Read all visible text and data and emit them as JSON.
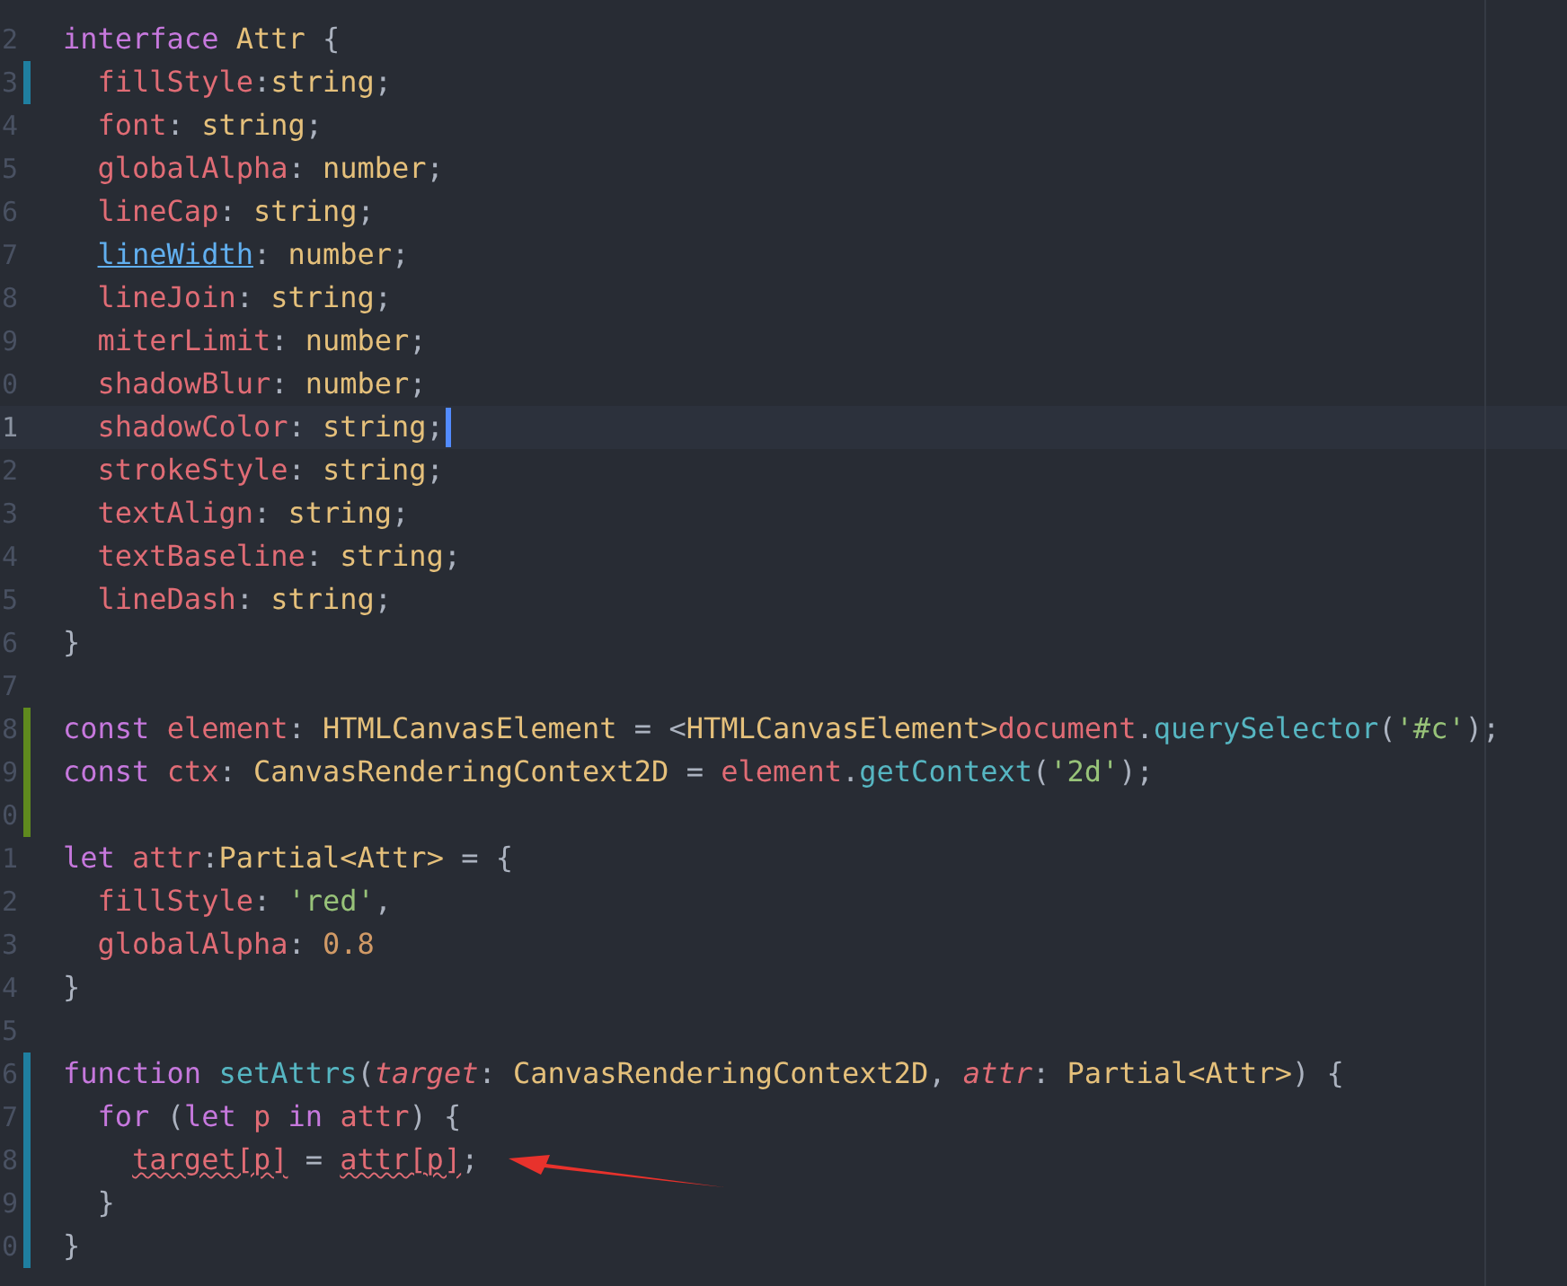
{
  "editor": {
    "lines": [
      {
        "number": "2",
        "changed": false,
        "current": false,
        "tokens": [
          {
            "text": "interface",
            "kind": "kw"
          },
          {
            "text": " Attr",
            "kind": "type"
          },
          {
            "text": " {",
            "kind": "punct"
          }
        ]
      },
      {
        "number": "3",
        "changed": true,
        "color": "#1f7fa0",
        "current": false,
        "tokens": [
          {
            "text": "  fillStyle",
            "kind": "name"
          },
          {
            "text": ":",
            "kind": "punct"
          },
          {
            "text": "string",
            "kind": "type"
          },
          {
            "text": ";",
            "kind": "punct"
          }
        ]
      },
      {
        "number": "4",
        "changed": false,
        "current": false,
        "tokens": [
          {
            "text": "  font",
            "kind": "name"
          },
          {
            "text": ": ",
            "kind": "punct"
          },
          {
            "text": "string",
            "kind": "type"
          },
          {
            "text": ";",
            "kind": "punct"
          }
        ]
      },
      {
        "number": "5",
        "changed": false,
        "current": false,
        "tokens": [
          {
            "text": "  globalAlpha",
            "kind": "name"
          },
          {
            "text": ": ",
            "kind": "punct"
          },
          {
            "text": "number",
            "kind": "type"
          },
          {
            "text": ";",
            "kind": "punct"
          }
        ]
      },
      {
        "number": "6",
        "changed": false,
        "current": false,
        "tokens": [
          {
            "text": "  lineCap",
            "kind": "name"
          },
          {
            "text": ": ",
            "kind": "punct"
          },
          {
            "text": "string",
            "kind": "type"
          },
          {
            "text": ";",
            "kind": "punct"
          }
        ]
      },
      {
        "number": "7",
        "changed": false,
        "current": false,
        "tokens": [
          {
            "text": "  lineWidth",
            "kind": "link"
          },
          {
            "text": ": ",
            "kind": "punct"
          },
          {
            "text": "number",
            "kind": "type"
          },
          {
            "text": ";",
            "kind": "punct"
          }
        ]
      },
      {
        "number": "8",
        "changed": false,
        "current": false,
        "tokens": [
          {
            "text": "  lineJoin",
            "kind": "name"
          },
          {
            "text": ": ",
            "kind": "punct"
          },
          {
            "text": "string",
            "kind": "type"
          },
          {
            "text": ";",
            "kind": "punct"
          }
        ]
      },
      {
        "number": "9",
        "changed": false,
        "current": false,
        "tokens": [
          {
            "text": "  miterLimit",
            "kind": "name"
          },
          {
            "text": ": ",
            "kind": "punct"
          },
          {
            "text": "number",
            "kind": "type"
          },
          {
            "text": ";",
            "kind": "punct"
          }
        ]
      },
      {
        "number": "0",
        "changed": false,
        "current": false,
        "tokens": [
          {
            "text": "  shadowBlur",
            "kind": "name"
          },
          {
            "text": ": ",
            "kind": "punct"
          },
          {
            "text": "number",
            "kind": "type"
          },
          {
            "text": ";",
            "kind": "punct"
          }
        ]
      },
      {
        "number": "1",
        "changed": false,
        "current": true,
        "tokens": [
          {
            "text": "  shadowColor",
            "kind": "name"
          },
          {
            "text": ": ",
            "kind": "punct"
          },
          {
            "text": "string",
            "kind": "type"
          },
          {
            "text": ";",
            "kind": "punct"
          }
        ]
      },
      {
        "number": "2",
        "changed": false,
        "current": false,
        "tokens": [
          {
            "text": "  strokeStyle",
            "kind": "name"
          },
          {
            "text": ": ",
            "kind": "punct"
          },
          {
            "text": "string",
            "kind": "type"
          },
          {
            "text": ";",
            "kind": "punct"
          }
        ]
      },
      {
        "number": "3",
        "changed": false,
        "current": false,
        "tokens": [
          {
            "text": "  textAlign",
            "kind": "name"
          },
          {
            "text": ": ",
            "kind": "punct"
          },
          {
            "text": "string",
            "kind": "type"
          },
          {
            "text": ";",
            "kind": "punct"
          }
        ]
      },
      {
        "number": "4",
        "changed": false,
        "current": false,
        "tokens": [
          {
            "text": "  textBaseline",
            "kind": "name"
          },
          {
            "text": ": ",
            "kind": "punct"
          },
          {
            "text": "string",
            "kind": "type"
          },
          {
            "text": ";",
            "kind": "punct"
          }
        ]
      },
      {
        "number": "5",
        "changed": false,
        "current": false,
        "tokens": [
          {
            "text": "  lineDash",
            "kind": "name"
          },
          {
            "text": ": ",
            "kind": "punct"
          },
          {
            "text": "string",
            "kind": "type"
          },
          {
            "text": ";",
            "kind": "punct"
          }
        ]
      },
      {
        "number": "6",
        "changed": false,
        "current": false,
        "tokens": [
          {
            "text": "}",
            "kind": "punct"
          }
        ]
      },
      {
        "number": "7",
        "changed": false,
        "current": false
      },
      {
        "number": "8",
        "changed": true,
        "color": "#5f8a1e",
        "current": false,
        "tokens": [
          {
            "text": "const",
            "kind": "kw"
          },
          {
            "text": " element",
            "kind": "name"
          },
          {
            "text": ": ",
            "kind": "punct"
          },
          {
            "text": "HTMLCanvasElement",
            "kind": "type"
          },
          {
            "text": " = <",
            "kind": "punct"
          },
          {
            "text": "HTMLCanvasElement>",
            "kind": "type"
          },
          {
            "text": "document",
            "kind": "name"
          },
          {
            "text": ".",
            "kind": "punct"
          },
          {
            "text": "querySelector",
            "kind": "fn"
          },
          {
            "text": "(",
            "kind": "punct"
          },
          {
            "text": "'#c'",
            "kind": "str"
          },
          {
            "text": ");",
            "kind": "punct"
          }
        ]
      },
      {
        "number": "9",
        "changed": true,
        "color": "#5f8a1e",
        "current": false,
        "tokens": [
          {
            "text": "const",
            "kind": "kw"
          },
          {
            "text": " ctx",
            "kind": "name"
          },
          {
            "text": ": ",
            "kind": "punct"
          },
          {
            "text": "CanvasRenderingContext2D",
            "kind": "type"
          },
          {
            "text": " = ",
            "kind": "punct"
          },
          {
            "text": "element",
            "kind": "name"
          },
          {
            "text": ".",
            "kind": "punct"
          },
          {
            "text": "getContext",
            "kind": "fn"
          },
          {
            "text": "(",
            "kind": "punct"
          },
          {
            "text": "'2d'",
            "kind": "str"
          },
          {
            "text": ");",
            "kind": "punct"
          }
        ]
      },
      {
        "number": "0",
        "changed": true,
        "color": "#5f8a1e",
        "current": false
      },
      {
        "number": "1",
        "changed": false,
        "current": false,
        "tokens": [
          {
            "text": "let",
            "kind": "kw"
          },
          {
            "text": " attr",
            "kind": "name"
          },
          {
            "text": ":",
            "kind": "punct"
          },
          {
            "text": "Partial<Attr>",
            "kind": "type"
          },
          {
            "text": " = {",
            "kind": "punct"
          }
        ]
      },
      {
        "number": "2",
        "changed": false,
        "current": false,
        "tokens": [
          {
            "text": "  fillStyle",
            "kind": "name"
          },
          {
            "text": ": ",
            "kind": "punct"
          },
          {
            "text": "'red'",
            "kind": "str"
          },
          {
            "text": ",",
            "kind": "punct"
          }
        ]
      },
      {
        "number": "3",
        "changed": false,
        "current": false,
        "tokens": [
          {
            "text": "  globalAlpha",
            "kind": "name"
          },
          {
            "text": ": ",
            "kind": "punct"
          },
          {
            "text": "0.8",
            "kind": "num"
          }
        ]
      },
      {
        "number": "4",
        "changed": false,
        "current": false,
        "tokens": [
          {
            "text": "}",
            "kind": "punct"
          }
        ]
      },
      {
        "number": "5",
        "changed": false,
        "current": false
      },
      {
        "number": "6",
        "changed": true,
        "color": "#1f7fa0",
        "current": false,
        "tokens": [
          {
            "text": "function",
            "kind": "kw"
          },
          {
            "text": " setAttrs",
            "kind": "fn"
          },
          {
            "text": "(",
            "kind": "punct"
          },
          {
            "text": "target",
            "kind": "param"
          },
          {
            "text": ": ",
            "kind": "punct"
          },
          {
            "text": "CanvasRenderingContext2D",
            "kind": "type"
          },
          {
            "text": ", ",
            "kind": "punct"
          },
          {
            "text": "attr",
            "kind": "param"
          },
          {
            "text": ": ",
            "kind": "punct"
          },
          {
            "text": "Partial<Attr>",
            "kind": "type"
          },
          {
            "text": ") {",
            "kind": "punct"
          }
        ]
      },
      {
        "number": "7",
        "changed": true,
        "color": "#1f7fa0",
        "current": false,
        "tokens": [
          {
            "text": "  for",
            "kind": "kw"
          },
          {
            "text": " (",
            "kind": "punct"
          },
          {
            "text": "let",
            "kind": "kw"
          },
          {
            "text": " p",
            "kind": "name"
          },
          {
            "text": " in",
            "kind": "kw"
          },
          {
            "text": " attr",
            "kind": "name"
          },
          {
            "text": ") {",
            "kind": "punct"
          }
        ]
      },
      {
        "number": "8",
        "changed": true,
        "color": "#1f7fa0",
        "current": false,
        "tokens": [
          {
            "text": "    target[p]",
            "kind": "error"
          },
          {
            "text": " = ",
            "kind": "punct"
          },
          {
            "text": "attr[p]",
            "kind": "error"
          },
          {
            "text": ";",
            "kind": "punct"
          }
        ]
      },
      {
        "number": "9",
        "changed": true,
        "color": "#1f7fa0",
        "current": false,
        "tokens": [
          {
            "text": "  }",
            "kind": "punct"
          }
        ]
      },
      {
        "number": "0",
        "changed": true,
        "color": "#1f7fa0",
        "current": false,
        "tokens": [
          {
            "text": "}",
            "kind": "punct"
          }
        ]
      }
    ]
  }
}
